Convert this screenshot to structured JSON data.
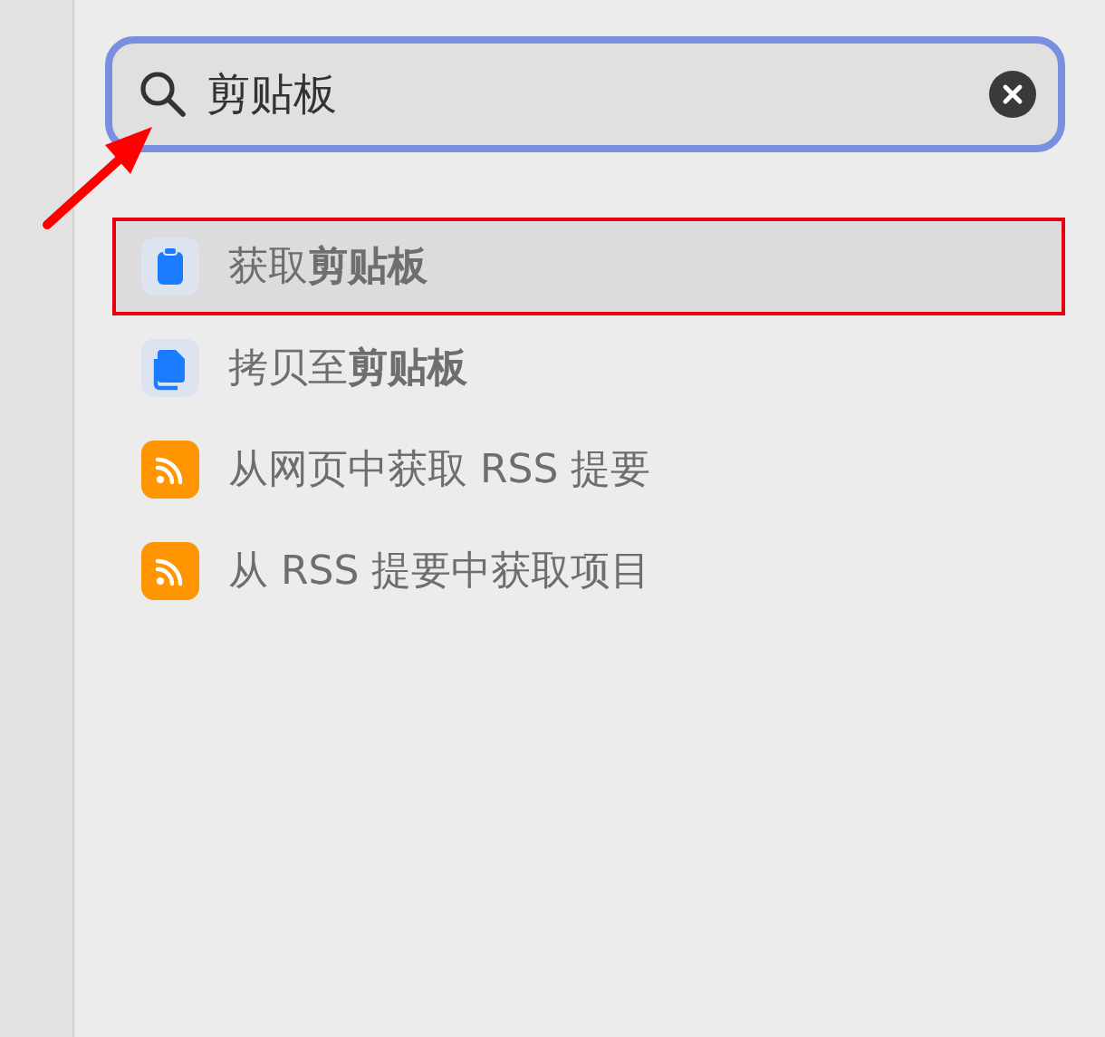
{
  "search": {
    "value": "剪贴板"
  },
  "results": [
    {
      "kind": "clipboard",
      "label": "获取**剪贴板**",
      "selected": true,
      "annotated": true
    },
    {
      "kind": "copy",
      "label": "拷贝至**剪贴板**",
      "selected": false,
      "annotated": false
    },
    {
      "kind": "rss",
      "label": "从网页中获取 RSS 提要",
      "selected": false,
      "annotated": false
    },
    {
      "kind": "rss",
      "label": "从 RSS 提要中获取项目",
      "selected": false,
      "annotated": false
    }
  ],
  "pointer_arrow": true
}
